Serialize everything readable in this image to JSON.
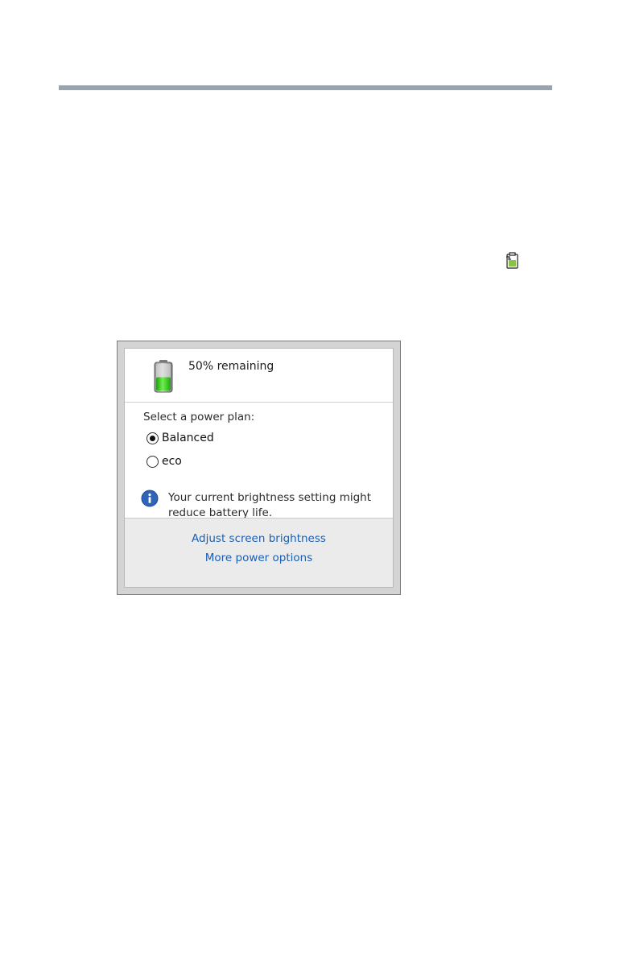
{
  "battery": {
    "status_text": "50% remaining",
    "charge_fraction": 0.5,
    "charge_color": "#3cc41e"
  },
  "power_plan": {
    "heading": "Select a power plan:",
    "options": [
      {
        "label": "Balanced",
        "selected": true
      },
      {
        "label": "eco",
        "selected": false
      }
    ]
  },
  "info": {
    "icon": "info-icon",
    "message": "Your current brightness setting might reduce battery life."
  },
  "links": {
    "adjust_brightness": "Adjust screen brightness",
    "more_power_options": "More power options"
  },
  "colors": {
    "link": "#1a5fb4",
    "rule": "#9aa4ae"
  }
}
